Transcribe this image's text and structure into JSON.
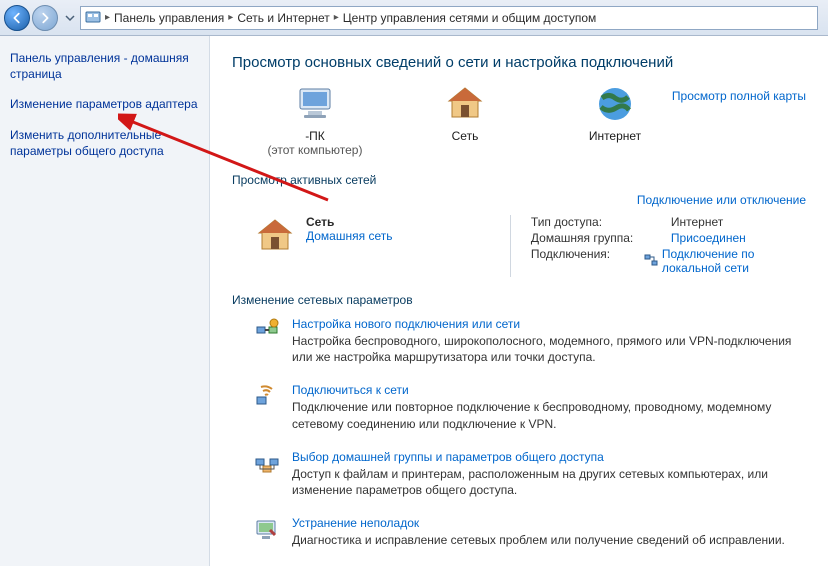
{
  "breadcrumb": {
    "items": [
      "Панель управления",
      "Сеть и Интернет",
      "Центр управления сетями и общим доступом"
    ]
  },
  "sidebar": {
    "items": [
      "Панель управления - домашняя страница",
      "Изменение параметров адаптера",
      "Изменить дополнительные параметры общего доступа"
    ]
  },
  "content": {
    "title": "Просмотр основных сведений о сети и настройка подключений",
    "full_map": "Просмотр полной карты",
    "map": {
      "pc_label": "-ПК",
      "pc_sub": "(этот компьютер)",
      "net_label": "Сеть",
      "internet_label": "Интернет"
    },
    "active_section": "Просмотр активных сетей",
    "connect_link": "Подключение или отключение",
    "network": {
      "name": "Сеть",
      "type": "Домашняя сеть",
      "access_k": "Тип доступа:",
      "access_v": "Интернет",
      "homegroup_k": "Домашняя группа:",
      "homegroup_v": "Присоединен",
      "conn_k": "Подключения:",
      "conn_v": "Подключение по локальной сети"
    },
    "settings_section": "Изменение сетевых параметров",
    "tasks": [
      {
        "title": "Настройка нового подключения или сети",
        "desc": "Настройка беспроводного, широкополосного, модемного, прямого или VPN-подключения или же настройка маршрутизатора или точки доступа."
      },
      {
        "title": "Подключиться к сети",
        "desc": "Подключение или повторное подключение к беспроводному, проводному, модемному сетевому соединению или подключение к VPN."
      },
      {
        "title": "Выбор домашней группы и параметров общего доступа",
        "desc": "Доступ к файлам и принтерам, расположенным на других сетевых компьютерах, или изменение параметров общего доступа."
      },
      {
        "title": "Устранение неполадок",
        "desc": "Диагностика и исправление сетевых проблем или получение сведений об исправлении."
      }
    ]
  }
}
